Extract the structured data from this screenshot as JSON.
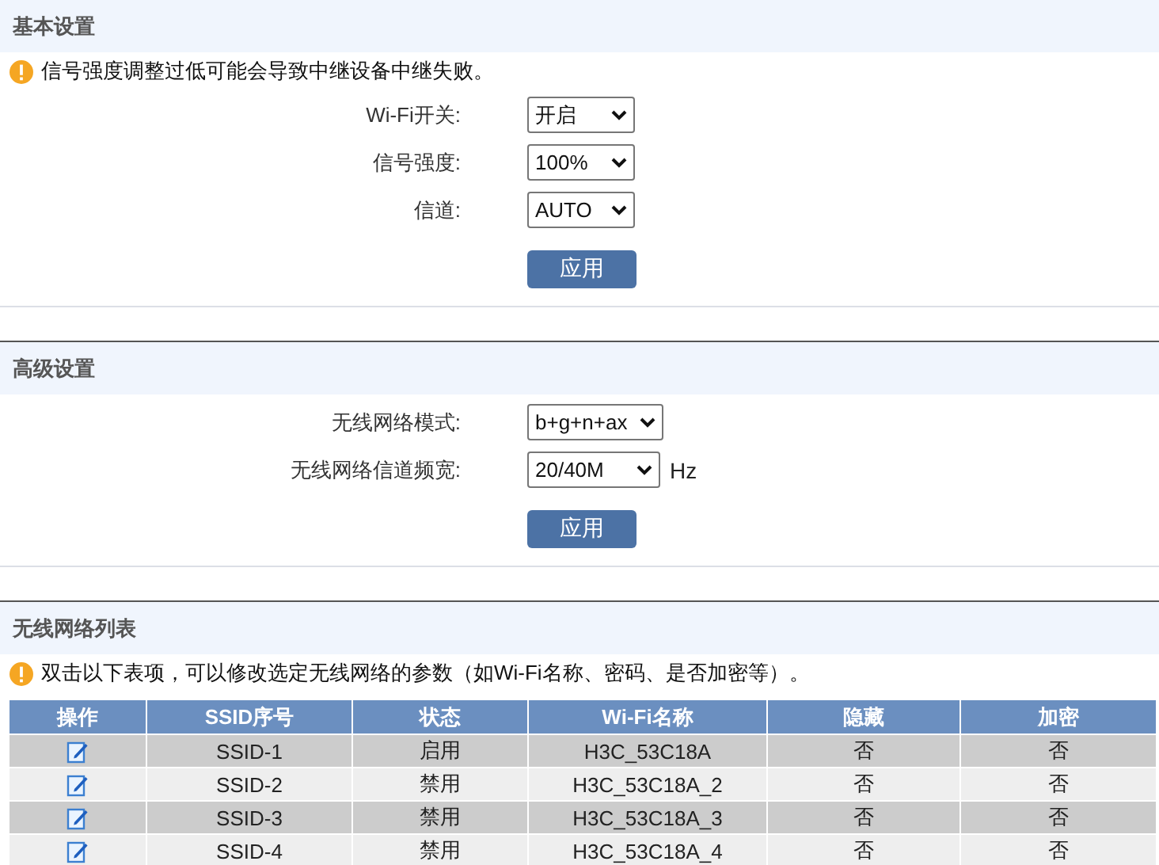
{
  "sections": [
    {
      "title": "基本设置",
      "notice": "信号强度调整过低可能会导致中继设备中继失败。",
      "fields": [
        {
          "label": "Wi-Fi开关:",
          "value": "开启"
        },
        {
          "label": "信号强度:",
          "value": "100%"
        },
        {
          "label": "信道:",
          "value": "AUTO"
        }
      ],
      "apply_button": "应用"
    },
    {
      "title": "高级设置",
      "fields": [
        {
          "label": "无线网络模式:",
          "value": "b+g+n+ax"
        },
        {
          "label": "无线网络信道频宽:",
          "value": "20/40M",
          "unit": "Hz"
        }
      ],
      "apply_button": "应用"
    },
    {
      "title": "无线网络列表",
      "notice": "双击以下表项，可以修改选定无线网络的参数（如Wi-Fi名称、密码、是否加密等）。",
      "table": {
        "columns": [
          "操作",
          "SSID序号",
          "状态",
          "Wi-Fi名称",
          "隐藏",
          "加密"
        ],
        "rows": [
          {
            "ssid": "SSID-1",
            "status": "启用",
            "wifi_name": "H3C_53C18A",
            "hidden": "否",
            "encryption": "否"
          },
          {
            "ssid": "SSID-2",
            "status": "禁用",
            "wifi_name": "H3C_53C18A_2",
            "hidden": "否",
            "encryption": "否"
          },
          {
            "ssid": "SSID-3",
            "status": "禁用",
            "wifi_name": "H3C_53C18A_3",
            "hidden": "否",
            "encryption": "否"
          },
          {
            "ssid": "SSID-4",
            "status": "禁用",
            "wifi_name": "H3C_53C18A_4",
            "hidden": "否",
            "encryption": "否"
          }
        ]
      }
    }
  ]
}
